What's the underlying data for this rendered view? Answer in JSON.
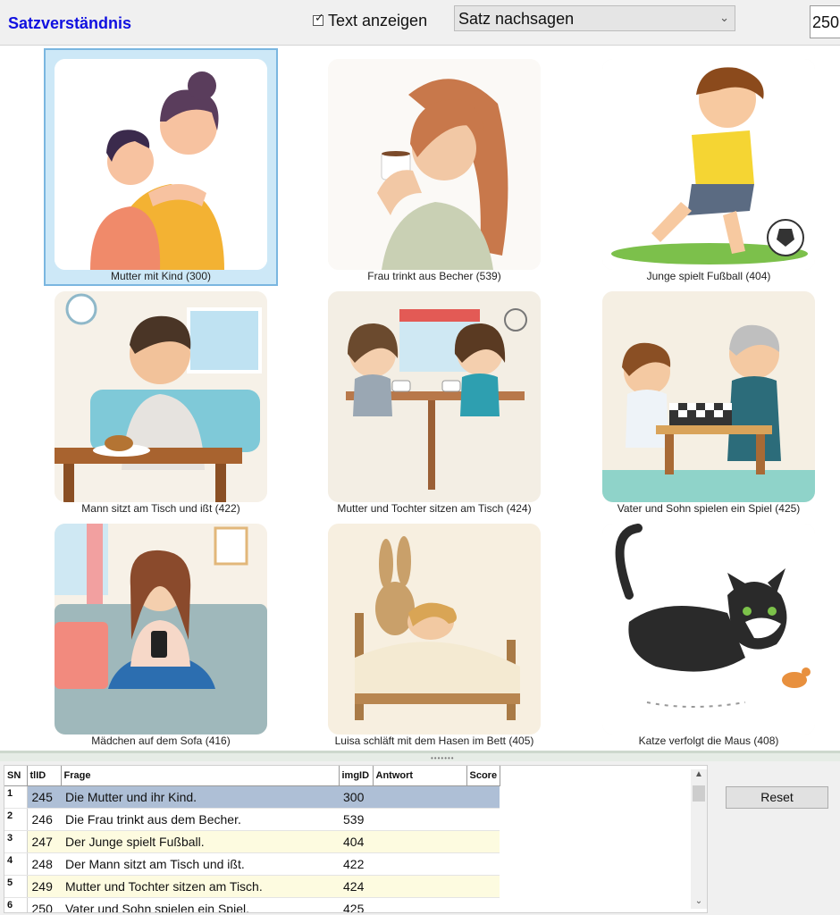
{
  "header": {
    "title": "Satzverständnis",
    "show_text_label": "Text anzeigen",
    "show_text_checked": true,
    "mode_value": "Satz nachsagen",
    "number_value": "250"
  },
  "cards": [
    {
      "caption": "Mutter mit Kind (300)",
      "selected": true
    },
    {
      "caption": "Frau trinkt aus Becher (539)"
    },
    {
      "caption": "Junge spielt Fußball (404)"
    },
    {
      "caption": "Mann sitzt am Tisch und ißt (422)"
    },
    {
      "caption": "Mutter und Tochter sitzen am Tisch (424)"
    },
    {
      "caption": "Vater und Sohn spielen ein Spiel (425)"
    },
    {
      "caption": "Mädchen auf dem Sofa (416)"
    },
    {
      "caption": "Luisa schläft mit dem Hasen im Bett (405)"
    },
    {
      "caption": "Katze verfolgt die Maus (408)"
    }
  ],
  "table": {
    "headers": {
      "sn": "SN",
      "tlid": "tlID",
      "frage": "Frage",
      "imgid": "imgID",
      "antwort": "Antwort",
      "score": "Score"
    },
    "rows": [
      {
        "sn": "1",
        "tlid": "245",
        "frage": "Die Mutter und ihr Kind.",
        "imgid": "300",
        "antwort": "",
        "score": ""
      },
      {
        "sn": "2",
        "tlid": "246",
        "frage": "Die Frau trinkt aus dem Becher.",
        "imgid": "539",
        "antwort": "",
        "score": ""
      },
      {
        "sn": "3",
        "tlid": "247",
        "frage": "Der Junge spielt Fußball.",
        "imgid": "404",
        "antwort": "",
        "score": ""
      },
      {
        "sn": "4",
        "tlid": "248",
        "frage": "Der Mann sitzt am Tisch und ißt.",
        "imgid": "422",
        "antwort": "",
        "score": ""
      },
      {
        "sn": "5",
        "tlid": "249",
        "frage": "Mutter und Tochter sitzen am Tisch.",
        "imgid": "424",
        "antwort": "",
        "score": ""
      },
      {
        "sn": "6",
        "tlid": "250",
        "frage": "Vater und Sohn spielen ein Spiel.",
        "imgid": "425",
        "antwort": "",
        "score": ""
      }
    ]
  },
  "reset_label": "Reset",
  "icons": {
    "checkbox": "checkmark-icon",
    "dropdown": "chevron-down-icon",
    "scroll_up": "arrow-up-icon",
    "scroll_down": "arrow-down-icon"
  },
  "colors": {
    "title": "#1010e0",
    "selected_row": "#aebfd6",
    "alt_row": "#fdfbe0",
    "selected_card": "#cde8f7"
  }
}
